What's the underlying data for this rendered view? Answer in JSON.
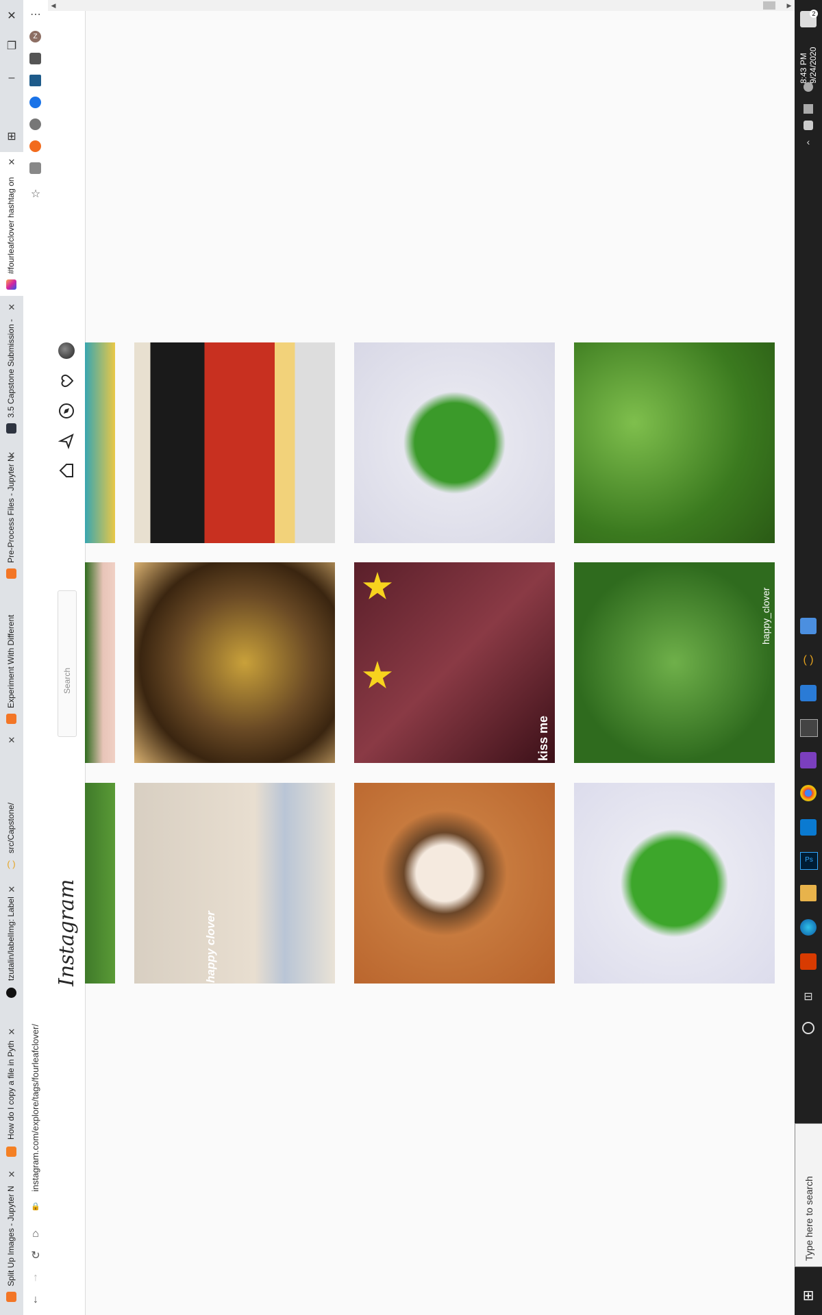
{
  "browser": {
    "tabs": [
      {
        "title": "#fourleafclover hashtag on",
        "active": true
      },
      {
        "title": "3.5 Capstone Submission -",
        "active": false
      },
      {
        "title": "Pre-Process Files - Jupyter N",
        "active": false
      },
      {
        "title": "Experiment With Different",
        "active": false
      },
      {
        "title": "src/Capstone/",
        "active": false
      },
      {
        "title": "tzutalin/labelImg: Label",
        "active": false
      },
      {
        "title": "How do I copy a file in Pyth",
        "active": false
      },
      {
        "title": "Split Up Images - Jupyter N",
        "active": false
      }
    ],
    "address": "instagram.com/explore/tags/fourleafclover/",
    "profile_initial": "Z"
  },
  "instagram": {
    "logo": "Instagram",
    "search_placeholder": "Search",
    "nav_icons": [
      "home-icon",
      "direct-icon",
      "explore-icon",
      "activity-heart-icon",
      "profile-avatar"
    ]
  },
  "grid": {
    "rows": [
      [
        {
          "desc": "clover-patch",
          "left_partial": true
        },
        {
          "desc": "happy-clover-sprout",
          "caption": "happy clover"
        },
        {
          "desc": "latte-clover-art"
        },
        {
          "desc": "four-leaf-clover-patterned"
        }
      ],
      [
        {
          "desc": "clover-patch-hand",
          "left_partial": true
        },
        {
          "desc": "food-bowl"
        },
        {
          "desc": "stars-stickers-photo",
          "caption": "kiss me"
        },
        {
          "desc": "clover-field",
          "caption": "happy_clover"
        }
      ],
      [
        {
          "desc": "sept-banner",
          "left_partial": true
        },
        {
          "desc": "fruit-platter"
        },
        {
          "desc": "clover-patterned-two"
        },
        {
          "desc": "clover-leaves-green"
        }
      ]
    ]
  },
  "taskbar": {
    "search_placeholder": "Type here to search",
    "time": "8:43 PM",
    "date": "9/24/2020",
    "notification_count": "2"
  }
}
